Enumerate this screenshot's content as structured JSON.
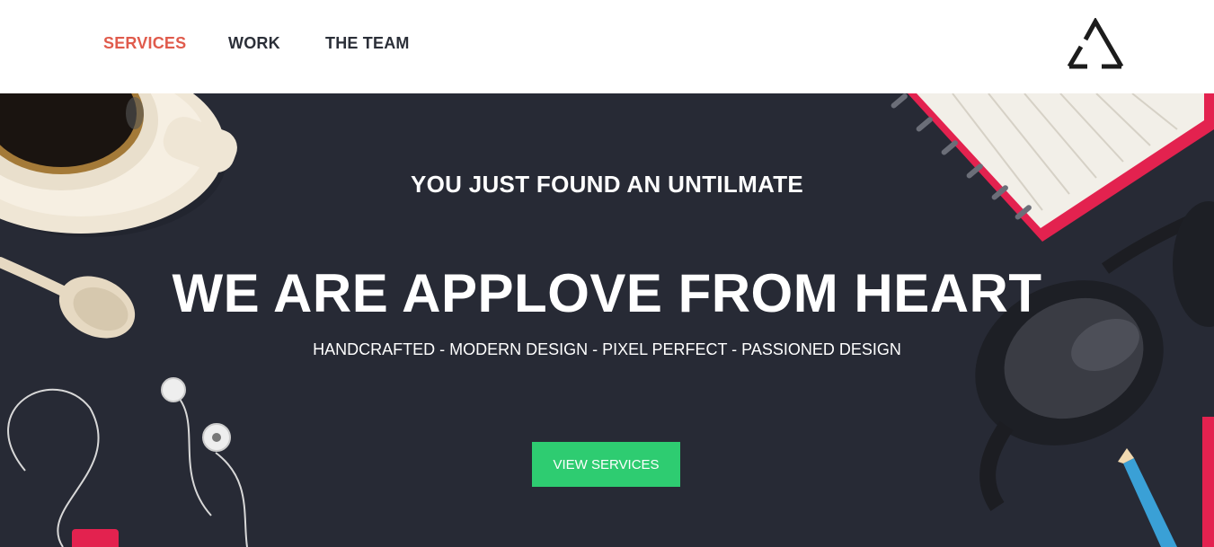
{
  "nav": {
    "items": [
      {
        "label": "SERVICES",
        "active": true
      },
      {
        "label": "WORK",
        "active": false
      },
      {
        "label": "THE TEAM",
        "active": false
      }
    ]
  },
  "hero": {
    "subtitle": "YOU JUST FOUND AN UNTILMATE",
    "headline": "WE ARE APPLOVE FROM HEART",
    "tagline": "HANDCRAFTED - MODERN DESIGN - PIXEL PERFECT - PASSIONED DESIGN",
    "cta_label": "VIEW SERVICES"
  },
  "colors": {
    "hero_bg": "#272a35",
    "accent_active_nav": "#e05b4c",
    "cta_green": "#2ecc71",
    "nav_text": "#2b2f38"
  },
  "icons": [
    "logo-triangle-icon",
    "coffee-cup-icon",
    "spoon-icon",
    "earphones-icon",
    "notebook-icon",
    "glasses-icon",
    "pencil-icon"
  ]
}
